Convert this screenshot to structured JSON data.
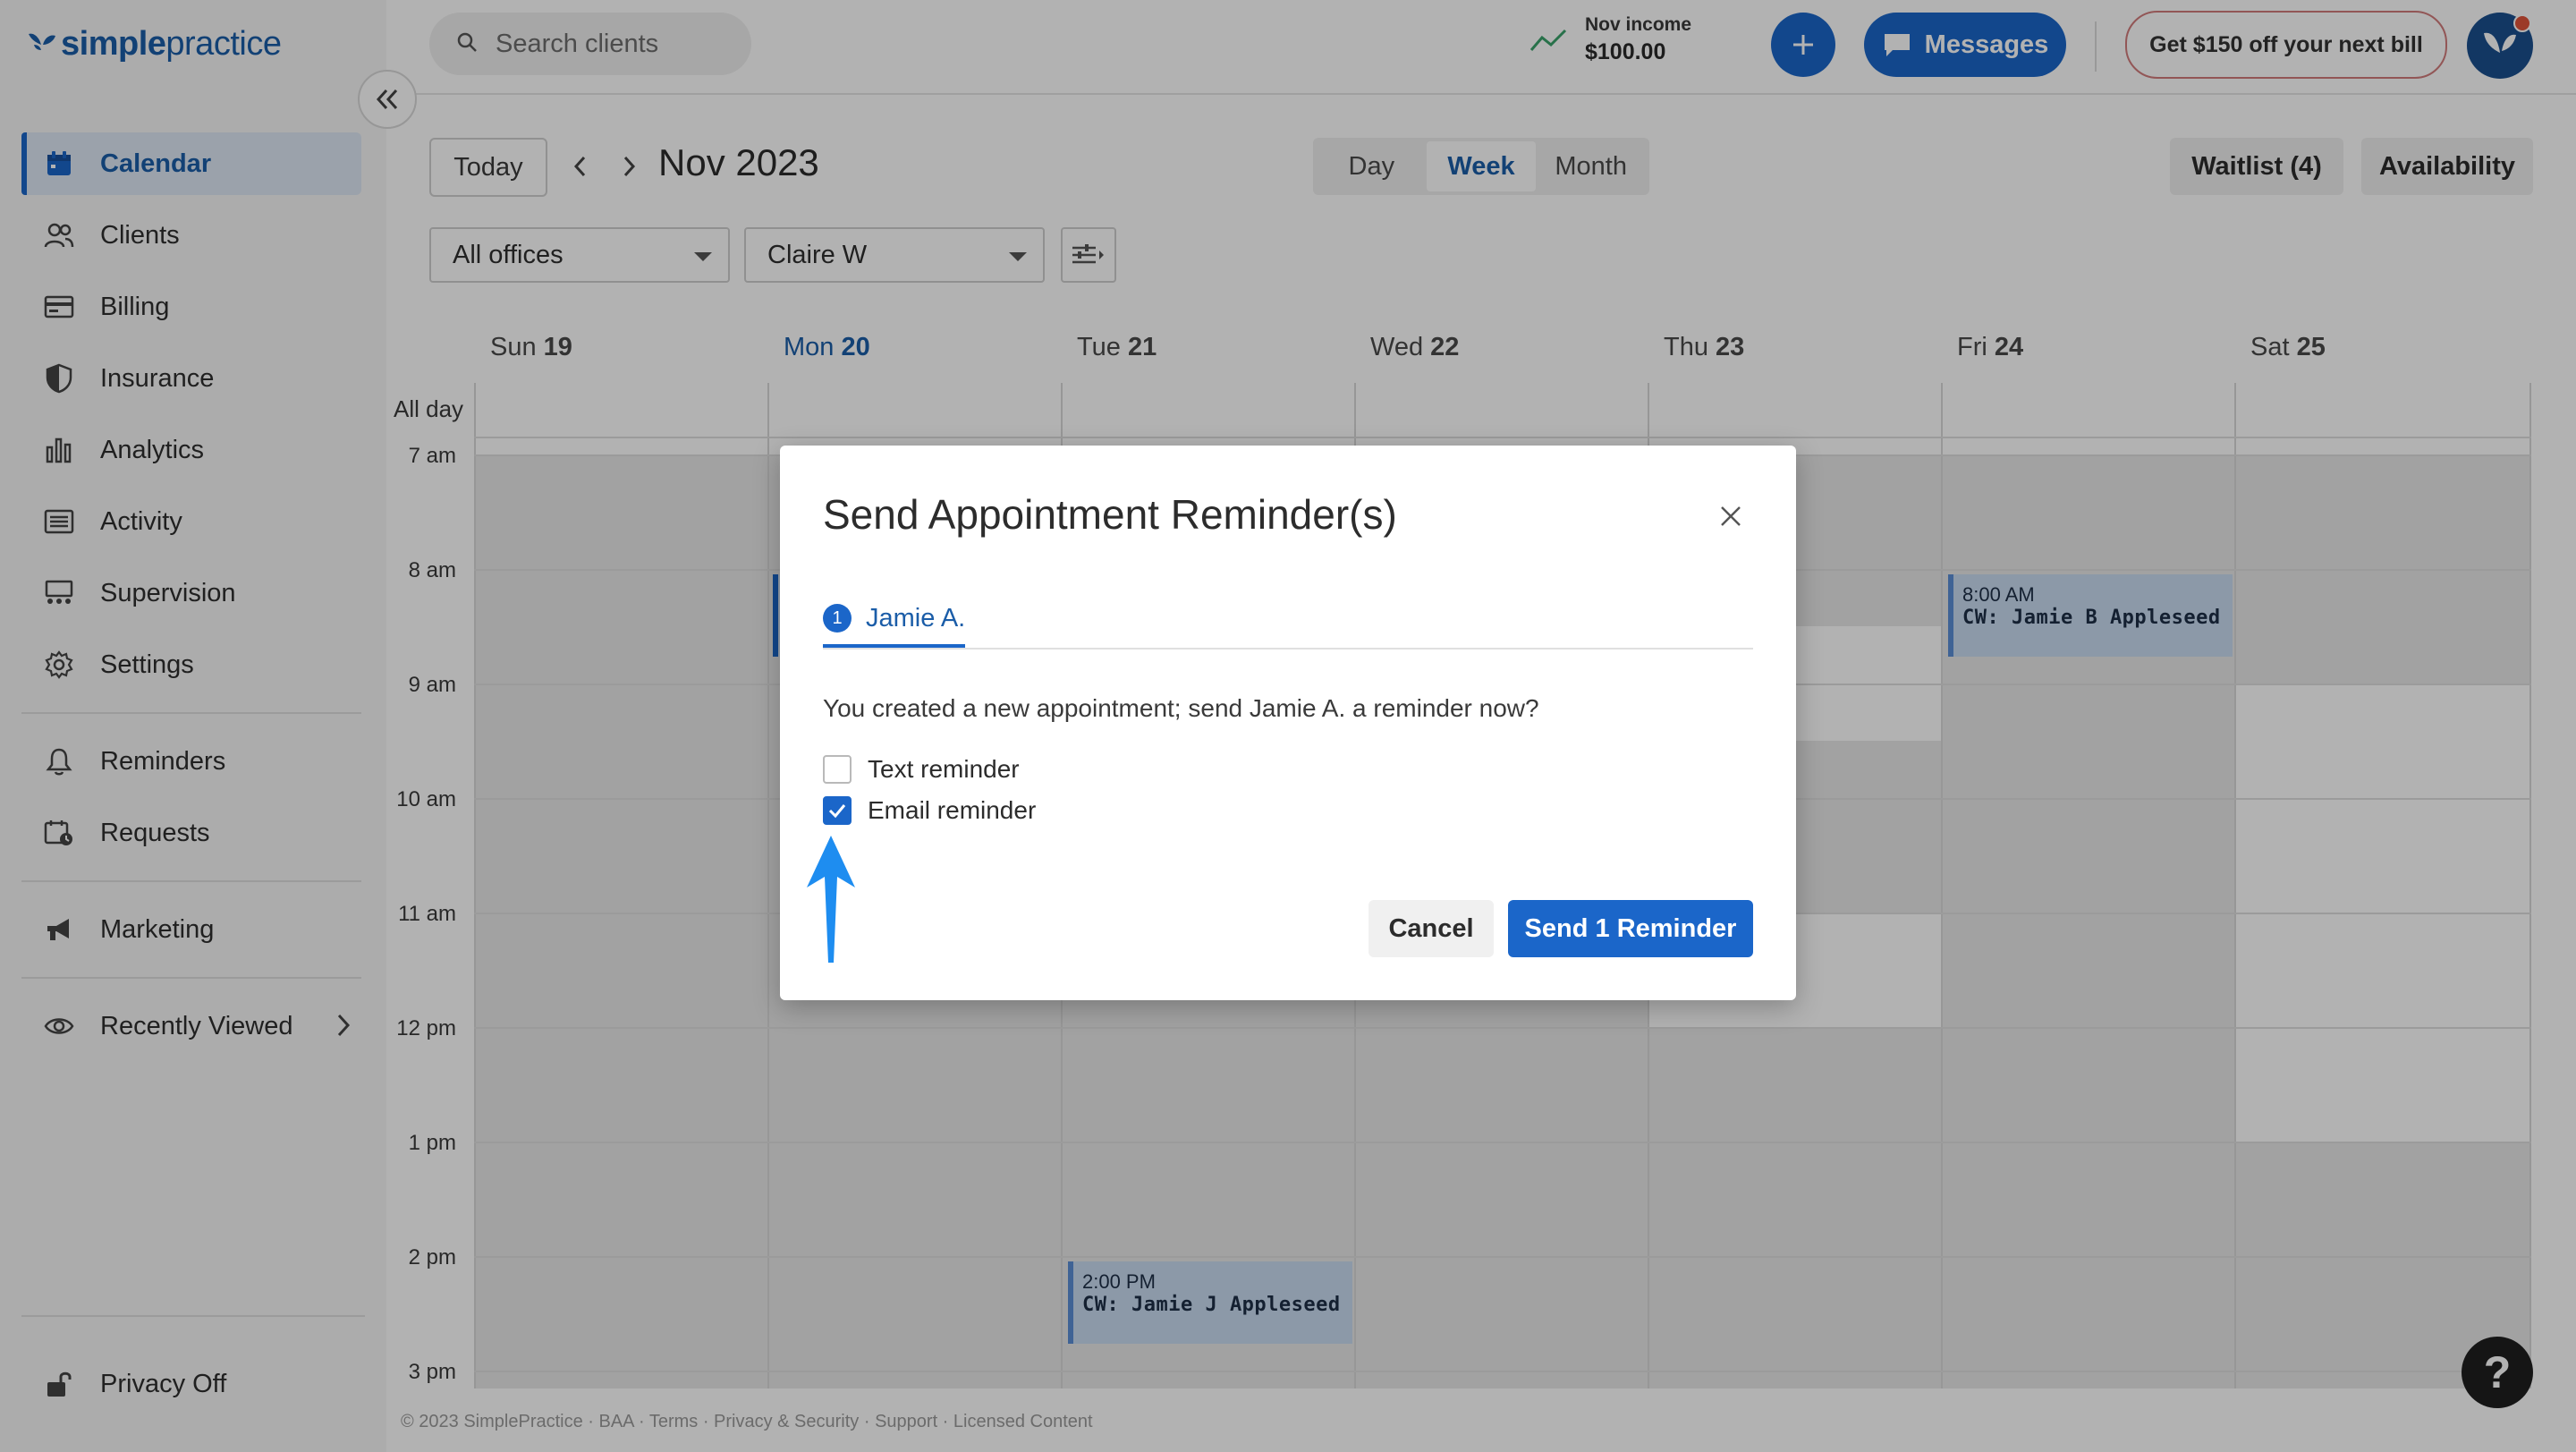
{
  "brand": {
    "name_bold": "simple",
    "name_light": "practice",
    "accent": "#1b66c9"
  },
  "sidebar": {
    "items": [
      {
        "label": "Calendar",
        "icon": "calendar-icon",
        "active": true
      },
      {
        "label": "Clients",
        "icon": "clients-icon"
      },
      {
        "label": "Billing",
        "icon": "billing-icon"
      },
      {
        "label": "Insurance",
        "icon": "shield-icon"
      },
      {
        "label": "Analytics",
        "icon": "analytics-icon"
      },
      {
        "label": "Activity",
        "icon": "activity-icon"
      },
      {
        "label": "Supervision",
        "icon": "supervision-icon"
      },
      {
        "label": "Settings",
        "icon": "gear-icon"
      }
    ],
    "items2": [
      {
        "label": "Reminders",
        "icon": "bell-icon"
      },
      {
        "label": "Requests",
        "icon": "calendar-clock-icon"
      }
    ],
    "items3": [
      {
        "label": "Marketing",
        "icon": "megaphone-icon"
      }
    ],
    "recently_viewed": "Recently Viewed",
    "privacy": "Privacy Off"
  },
  "topbar": {
    "search_placeholder": "Search clients",
    "income_label": "Nov income",
    "income_value": "$100.00",
    "messages": "Messages",
    "promo": "Get $150 off your next bill"
  },
  "toolbar": {
    "today": "Today",
    "month": "Nov 2023",
    "views": [
      "Day",
      "Week",
      "Month"
    ],
    "selected_view": "Week",
    "waitlist": "Waitlist (4)",
    "availability": "Availability",
    "office_filter": "All offices",
    "clinician_filter": "Claire W"
  },
  "calendar": {
    "days": [
      {
        "dow": "Sun",
        "num": "19"
      },
      {
        "dow": "Mon",
        "num": "20",
        "today": true
      },
      {
        "dow": "Tue",
        "num": "21"
      },
      {
        "dow": "Wed",
        "num": "22"
      },
      {
        "dow": "Thu",
        "num": "23"
      },
      {
        "dow": "Fri",
        "num": "24"
      },
      {
        "dow": "Sat",
        "num": "25"
      }
    ],
    "all_day": "All day",
    "hours": [
      "7 am",
      "8 am",
      "9 am",
      "10 am",
      "11 am",
      "12 pm",
      "1 pm",
      "2 pm",
      "3 pm"
    ],
    "appointments": [
      {
        "time": "8:00 AM",
        "name": "CW: Jamie B Appleseed"
      },
      {
        "time": "2:00 PM",
        "name": "CW: Jamie J Appleseed"
      }
    ]
  },
  "footer": "© 2023 SimplePractice · BAA · Terms · Privacy & Security · Support · Licensed Content",
  "modal": {
    "title": "Send Appointment Reminder(s)",
    "tab_number": "1",
    "tab_label": "Jamie A.",
    "message": "You created a new appointment; send Jamie A. a reminder now?",
    "text_reminder": "Text reminder",
    "text_checked": false,
    "email_reminder": "Email reminder",
    "email_checked": true,
    "cancel": "Cancel",
    "send": "Send 1 Reminder"
  },
  "help": "?"
}
